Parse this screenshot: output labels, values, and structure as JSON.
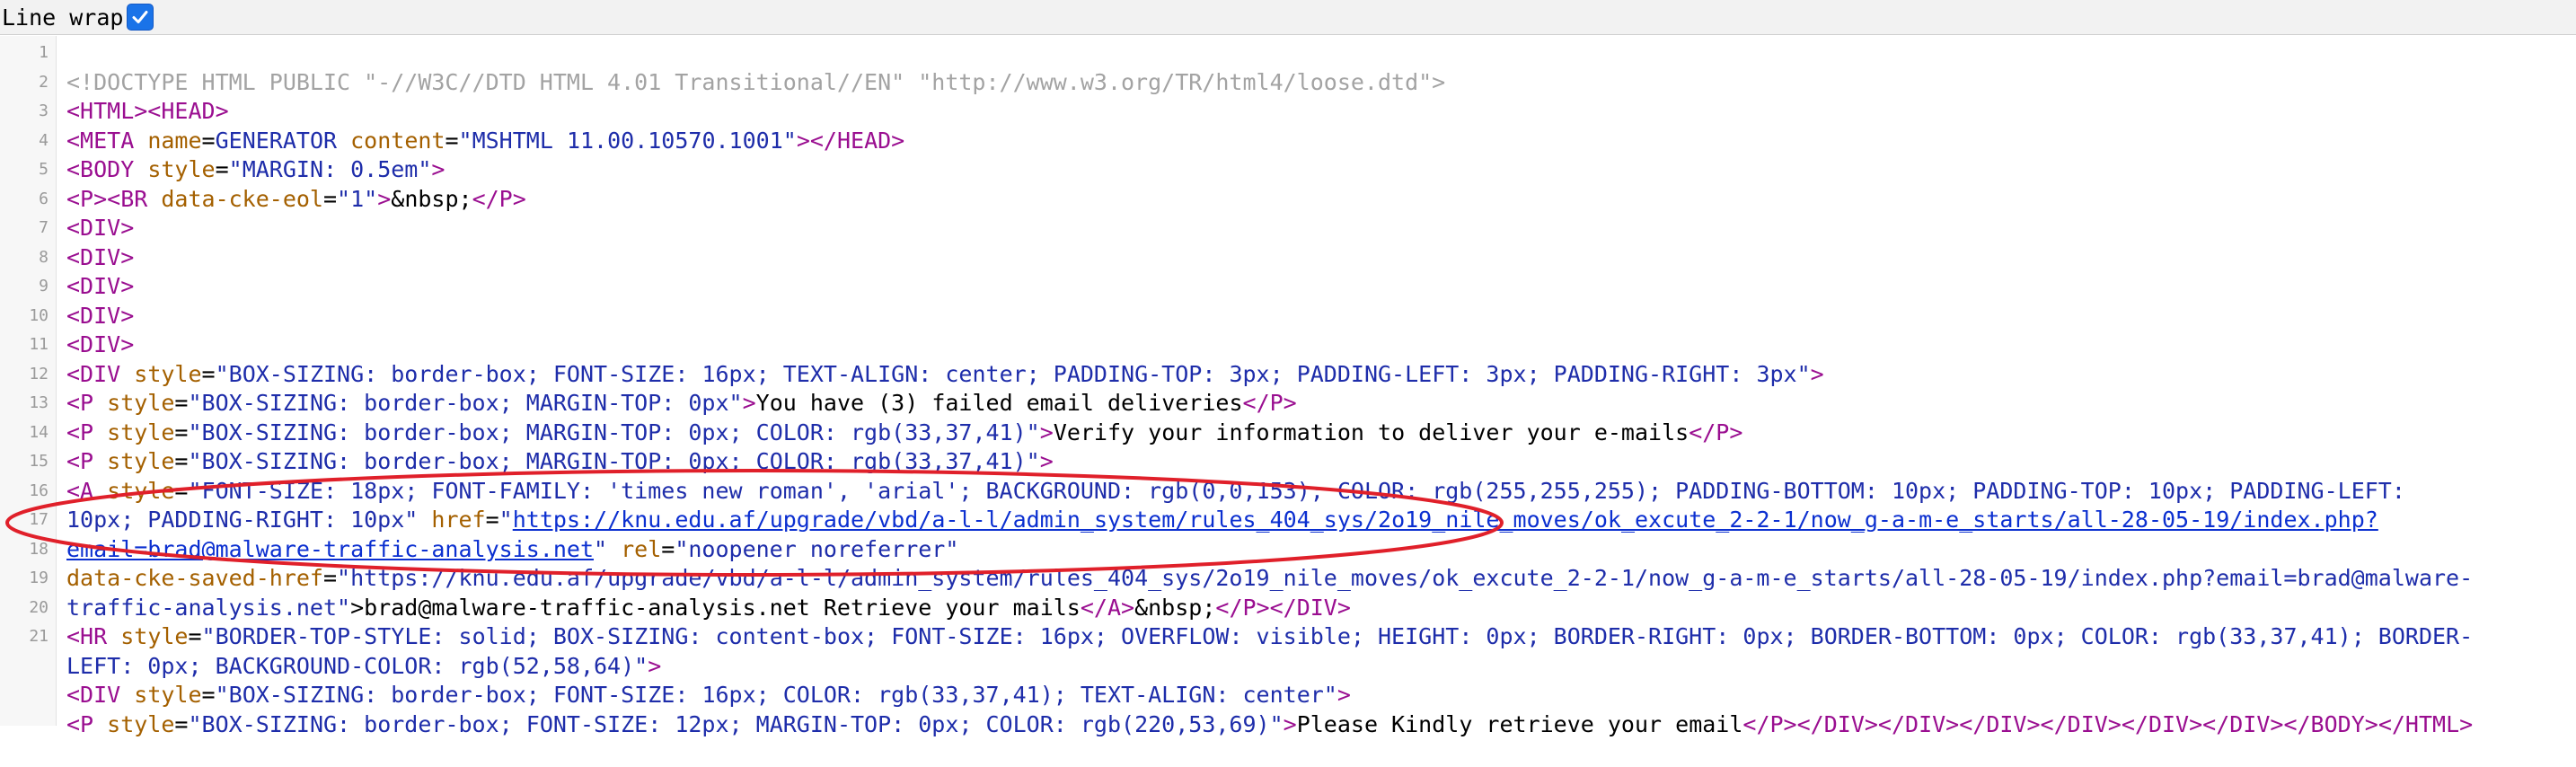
{
  "toolbar": {
    "line_wrap_label": "Line wrap",
    "line_wrap_checked": true
  },
  "colors": {
    "annotation_ellipse": "#e0202a",
    "tag": "#9a0e90",
    "attribute": "#a46000",
    "value": "#1e2daa",
    "link": "#0b2fd0",
    "doctype": "#a3a3a3",
    "checkbox": "#1a73e8"
  },
  "line_numbers": [
    "1",
    "2",
    "3",
    "4",
    "5",
    "6",
    "7",
    "8",
    "9",
    "10",
    "11",
    "12",
    "13",
    "14",
    "15",
    "16",
    "17",
    "18",
    "19",
    "20",
    "21"
  ],
  "lines": [
    [],
    [
      {
        "t": "dt",
        "s": "<!DOCTYPE HTML PUBLIC \"-//W3C//DTD HTML 4.01 Transitional//EN\" \"http://www.w3.org/TR/html4/loose.dtd\">"
      }
    ],
    [
      {
        "t": "tg",
        "s": "<HTML><HEAD>"
      }
    ],
    [
      {
        "t": "tg",
        "s": "<META "
      },
      {
        "t": "at",
        "s": "name"
      },
      {
        "t": "tx",
        "s": "="
      },
      {
        "t": "vl",
        "s": "GENERATOR "
      },
      {
        "t": "at",
        "s": "content"
      },
      {
        "t": "tx",
        "s": "="
      },
      {
        "t": "vl",
        "s": "\"MSHTML 11.00.10570.1001\""
      },
      {
        "t": "tg",
        "s": "></HEAD>"
      }
    ],
    [
      {
        "t": "tg",
        "s": "<BODY "
      },
      {
        "t": "at",
        "s": "style"
      },
      {
        "t": "tx",
        "s": "="
      },
      {
        "t": "vl",
        "s": "\"MARGIN: 0.5em\""
      },
      {
        "t": "tg",
        "s": ">"
      }
    ],
    [
      {
        "t": "tg",
        "s": "<P><BR "
      },
      {
        "t": "at",
        "s": "data-cke-eol"
      },
      {
        "t": "tx",
        "s": "="
      },
      {
        "t": "vl",
        "s": "\"1\""
      },
      {
        "t": "tg",
        "s": ">"
      },
      {
        "t": "tx",
        "s": "&nbsp;"
      },
      {
        "t": "tg",
        "s": "</P>"
      }
    ],
    [
      {
        "t": "tg",
        "s": "<DIV>"
      }
    ],
    [
      {
        "t": "tg",
        "s": "<DIV>"
      }
    ],
    [
      {
        "t": "tg",
        "s": "<DIV>"
      }
    ],
    [
      {
        "t": "tg",
        "s": "<DIV>"
      }
    ],
    [
      {
        "t": "tg",
        "s": "<DIV>"
      }
    ],
    [
      {
        "t": "tg",
        "s": "<DIV "
      },
      {
        "t": "at",
        "s": "style"
      },
      {
        "t": "tx",
        "s": "="
      },
      {
        "t": "vl",
        "s": "\"BOX-SIZING: border-box; FONT-SIZE: 16px; TEXT-ALIGN: center; PADDING-TOP: 3px; PADDING-LEFT: 3px; PADDING-RIGHT: 3px\""
      },
      {
        "t": "tg",
        "s": ">"
      }
    ],
    [
      {
        "t": "tg",
        "s": "<P "
      },
      {
        "t": "at",
        "s": "style"
      },
      {
        "t": "tx",
        "s": "="
      },
      {
        "t": "vl",
        "s": "\"BOX-SIZING: border-box; MARGIN-TOP: 0px\""
      },
      {
        "t": "tg",
        "s": ">"
      },
      {
        "t": "tx",
        "s": "You have (3) failed email deliveries"
      },
      {
        "t": "tg",
        "s": "</P>"
      }
    ],
    [
      {
        "t": "tg",
        "s": "<P "
      },
      {
        "t": "at",
        "s": "style"
      },
      {
        "t": "tx",
        "s": "="
      },
      {
        "t": "vl",
        "s": "\"BOX-SIZING: border-box; MARGIN-TOP: 0px; COLOR: rgb(33,37,41)\""
      },
      {
        "t": "tg",
        "s": ">"
      },
      {
        "t": "tx",
        "s": "Verify your information to deliver your e-mails"
      },
      {
        "t": "tg",
        "s": "</P>"
      }
    ],
    [
      {
        "t": "tg",
        "s": "<P "
      },
      {
        "t": "at",
        "s": "style"
      },
      {
        "t": "tx",
        "s": "="
      },
      {
        "t": "vl",
        "s": "\"BOX-SIZING: border-box; MARGIN-TOP: 0px; COLOR: rgb(33,37,41)\""
      },
      {
        "t": "tg",
        "s": ">"
      }
    ],
    [
      {
        "t": "tg",
        "s": "<A "
      },
      {
        "t": "at",
        "s": "style"
      },
      {
        "t": "tx",
        "s": "="
      },
      {
        "t": "vl",
        "s": "\"FONT-SIZE: 18px; FONT-FAMILY: 'times new roman', 'arial'; BACKGROUND: rgb(0,0,153); COLOR: rgb(255,255,255); PADDING-BOTTOM: 10px; PADDING-TOP: 10px; PADDING-LEFT:"
      }
    ],
    [
      {
        "t": "vl",
        "s": "10px; PADDING-RIGHT: 10px\" "
      },
      {
        "t": "at",
        "s": "href"
      },
      {
        "t": "tx",
        "s": "="
      },
      {
        "t": "vl",
        "s": "\""
      },
      {
        "t": "lk",
        "s": "https://knu.edu.af/upgrade/vbd/a-l-l/admin_system/rules_404_sys/2o19_nile_moves/ok_excute_2-2-1/now_g-a-m-e_starts/all-28-05-19/index.php?"
      }
    ],
    [
      {
        "t": "lk",
        "s": "email=brad@malware-traffic-analysis.net"
      },
      {
        "t": "vl",
        "s": "\" "
      },
      {
        "t": "at",
        "s": "rel"
      },
      {
        "t": "tx",
        "s": "="
      },
      {
        "t": "vl",
        "s": "\"noopener noreferrer\""
      }
    ],
    [
      {
        "t": "at",
        "s": "data-cke-saved-href"
      },
      {
        "t": "tx",
        "s": "="
      },
      {
        "t": "vl",
        "s": "\"https://knu.edu.af/upgrade/vbd/a-l-l/admin_system/rules_404_sys/2o19_nile_moves/ok_excute_2-2-1/now_g-a-m-e_starts/all-28-05-19/index.php?email=brad@malware-"
      }
    ],
    [
      {
        "t": "vl",
        "s": "traffic-analysis.net\""
      },
      {
        "t": "tx",
        "s": ">brad@malware-traffic-analysis.net Retrieve your mails"
      },
      {
        "t": "tg",
        "s": "</A>"
      },
      {
        "t": "tx",
        "s": "&nbsp;"
      },
      {
        "t": "tg",
        "s": "</P></DIV>"
      }
    ],
    [
      {
        "t": "tg",
        "s": "<HR "
      },
      {
        "t": "at",
        "s": "style"
      },
      {
        "t": "tx",
        "s": "="
      },
      {
        "t": "vl",
        "s": "\"BORDER-TOP-STYLE: solid; BOX-SIZING: content-box; FONT-SIZE: 16px; OVERFLOW: visible; HEIGHT: 0px; BORDER-RIGHT: 0px; BORDER-BOTTOM: 0px; COLOR: rgb(33,37,41); BORDER-"
      }
    ],
    [
      {
        "t": "vl",
        "s": "LEFT: 0px; BACKGROUND-COLOR: rgb(52,58,64)\""
      },
      {
        "t": "tg",
        "s": ">"
      }
    ],
    [
      {
        "t": "tg",
        "s": "<DIV "
      },
      {
        "t": "at",
        "s": "style"
      },
      {
        "t": "tx",
        "s": "="
      },
      {
        "t": "vl",
        "s": "\"BOX-SIZING: border-box; FONT-SIZE: 16px; COLOR: rgb(33,37,41); TEXT-ALIGN: center\""
      },
      {
        "t": "tg",
        "s": ">"
      }
    ],
    [
      {
        "t": "tg",
        "s": "<P "
      },
      {
        "t": "at",
        "s": "style"
      },
      {
        "t": "tx",
        "s": "="
      },
      {
        "t": "vl",
        "s": "\"BOX-SIZING: border-box; FONT-SIZE: 12px; MARGIN-TOP: 0px; COLOR: rgb(220,53,69)\""
      },
      {
        "t": "tg",
        "s": ">"
      },
      {
        "t": "tx",
        "s": "Please Kindly retrieve your email"
      },
      {
        "t": "tg",
        "s": "</P></DIV></DIV></DIV></DIV></DIV></DIV></BODY></HTML>"
      }
    ],
    []
  ]
}
